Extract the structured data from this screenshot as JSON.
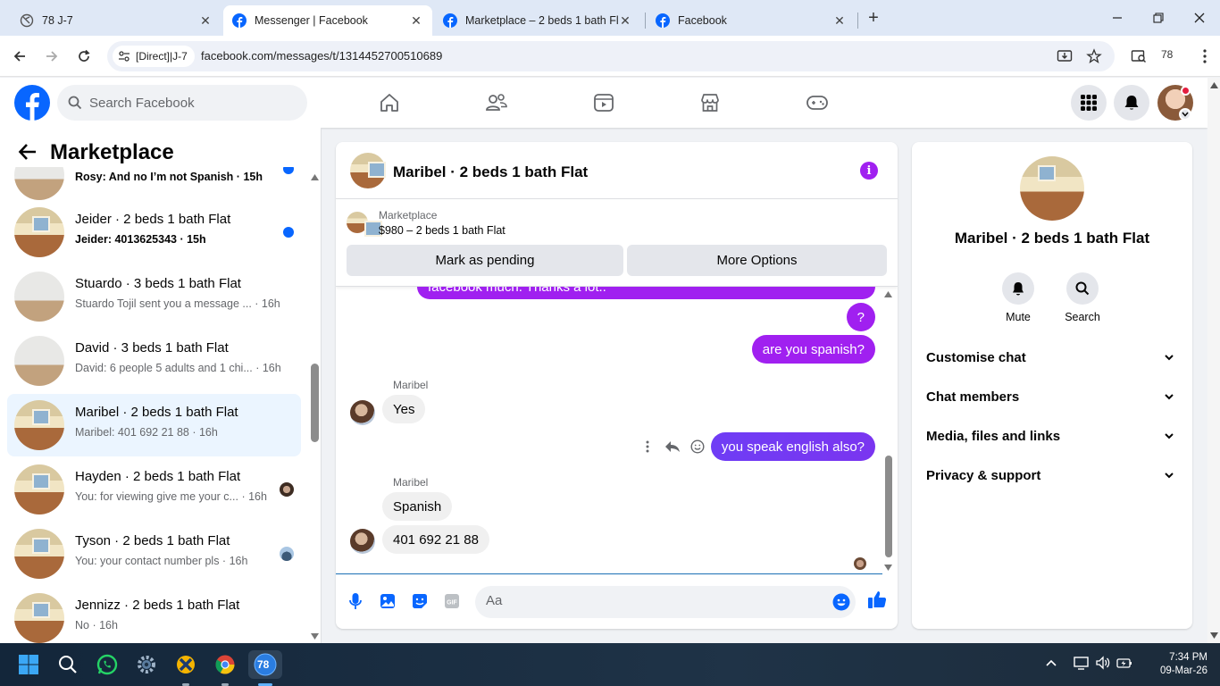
{
  "browser": {
    "tabs": [
      {
        "title": "78 J-7",
        "active": false
      },
      {
        "title": "Messenger | Facebook",
        "active": true
      },
      {
        "title": "Marketplace – 2 beds 1 bath Fla",
        "active": false
      },
      {
        "title": "Facebook",
        "active": false
      }
    ],
    "site_chip": "[Direct]|J-7",
    "url": "facebook.com/messages/t/1314452700510689",
    "profile_count": "78"
  },
  "fb": {
    "search_placeholder": "Search Facebook"
  },
  "left": {
    "title": "Marketplace",
    "conversations": [
      {
        "name": "",
        "preview": "Rosy: And no I’m not Spanish",
        "time": "15h",
        "unread": true,
        "avatar": "room"
      },
      {
        "name": "Jeider · 2 beds 1 bath Flat",
        "preview": "Jeider: 4013625343",
        "time": "15h",
        "unread": true,
        "avatar": "room"
      },
      {
        "name": "Stuardo · 3 beds 1 bath Flat",
        "preview": "Stuardo Tojil sent you a message ...",
        "time": "16h",
        "unread": false,
        "avatar": "white"
      },
      {
        "name": "David · 3 beds 1 bath Flat",
        "preview": "David: 6 people 5 adults and 1 chi...",
        "time": "16h",
        "unread": false,
        "avatar": "white"
      },
      {
        "name": "Maribel · 2 beds 1 bath Flat",
        "preview": "Maribel: 401 692 21 88",
        "time": "16h",
        "unread": false,
        "avatar": "room",
        "selected": true
      },
      {
        "name": "Hayden · 2 beds 1 bath Flat",
        "preview": "You: for viewing give me your c...",
        "time": "16h",
        "unread": false,
        "avatar": "room"
      },
      {
        "name": "Tyson · 2 beds 1 bath Flat",
        "preview": "You: your contact number pls",
        "time": "16h",
        "unread": false,
        "avatar": "room"
      },
      {
        "name": "Jennizz · 2 beds 1 bath Flat",
        "preview": "No",
        "time": "16h",
        "unread": false,
        "avatar": "room"
      }
    ]
  },
  "chat": {
    "title": "Maribel · 2 beds 1 bath Flat",
    "listing": {
      "category": "Marketplace",
      "title": "$980 – 2 beds 1 bath Flat",
      "pending_label": "Mark as pending",
      "options_label": "More Options"
    },
    "messages": {
      "m0": "facebook much. Thanks a lot..",
      "m1": "?",
      "m2": "are you spanish?",
      "sender1": "Maribel",
      "m3": "Yes",
      "m4": "you speak english also?",
      "sender2": "Maribel",
      "m5": "Spanish",
      "m6": "401 692 21 88"
    },
    "composer_placeholder": "Aa"
  },
  "info": {
    "name": "Maribel · 2 beds 1 bath Flat",
    "mute_label": "Mute",
    "search_label": "Search",
    "rows": [
      "Customise chat",
      "Chat members",
      "Media, files and links",
      "Privacy & support"
    ]
  },
  "taskbar": {
    "time": "7:34 PM",
    "date": "09-Mar-26",
    "active_badge": "78"
  },
  "colors": {
    "fb_blue": "#0866ff",
    "bubble_out": "#a020f0",
    "selected_row": "#ebf5ff"
  }
}
